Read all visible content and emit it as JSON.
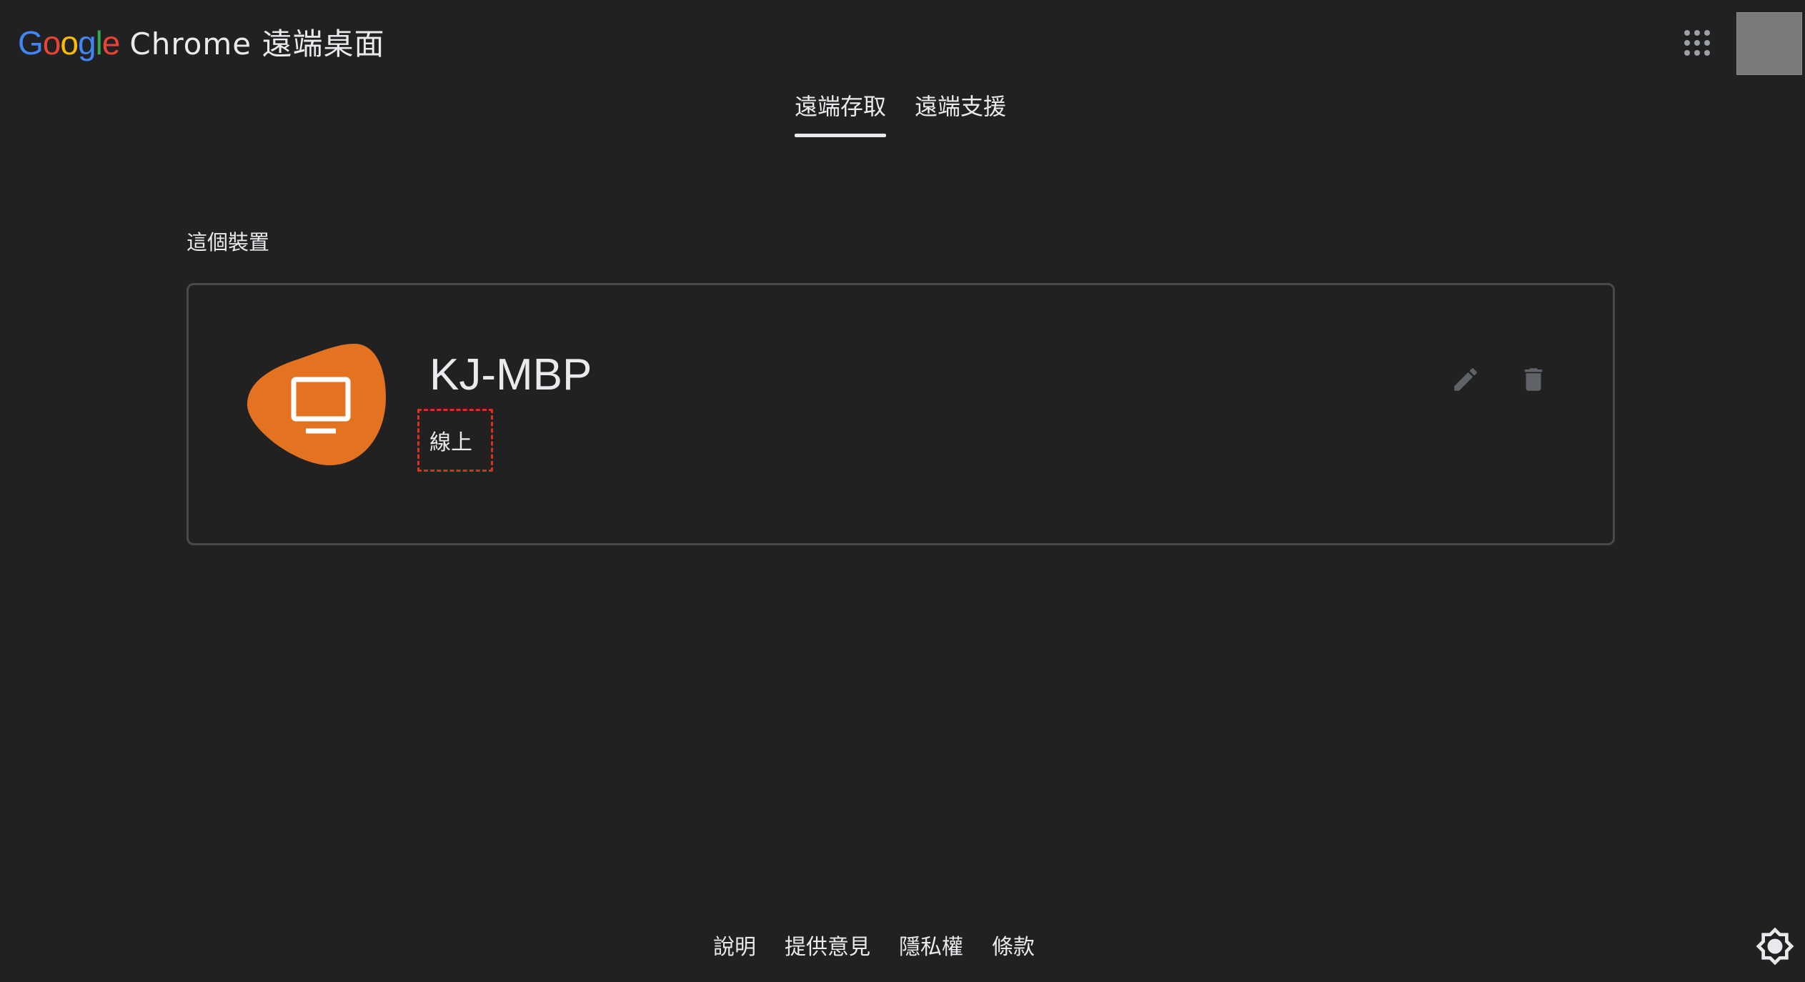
{
  "header": {
    "google_letters": [
      "G",
      "o",
      "o",
      "g",
      "l",
      "e"
    ],
    "product_name": "Chrome 遠端桌面",
    "apps_icon": "apps-grid-icon",
    "avatar": "account-avatar"
  },
  "tabs": [
    {
      "label": "遠端存取",
      "active": true
    },
    {
      "label": "遠端支援",
      "active": false
    }
  ],
  "section": {
    "title": "這個裝置"
  },
  "device": {
    "name": "KJ-MBP",
    "status": "線上",
    "icon": "monitor-icon",
    "blob_color": "#e37320",
    "actions": {
      "edit_icon": "pencil-icon",
      "delete_icon": "trash-icon"
    }
  },
  "footer": {
    "links": [
      "說明",
      "提供意見",
      "隱私權",
      "條款"
    ]
  },
  "theme_icon": "brightness-icon",
  "colors": {
    "background": "#212121",
    "text": "#e8eaed",
    "card_border": "#4a4a4a",
    "highlight_box": "#d93025",
    "google_blue": "#4285f4",
    "google_red": "#ea4335",
    "google_yellow": "#fbbc05",
    "google_green": "#34a853"
  }
}
